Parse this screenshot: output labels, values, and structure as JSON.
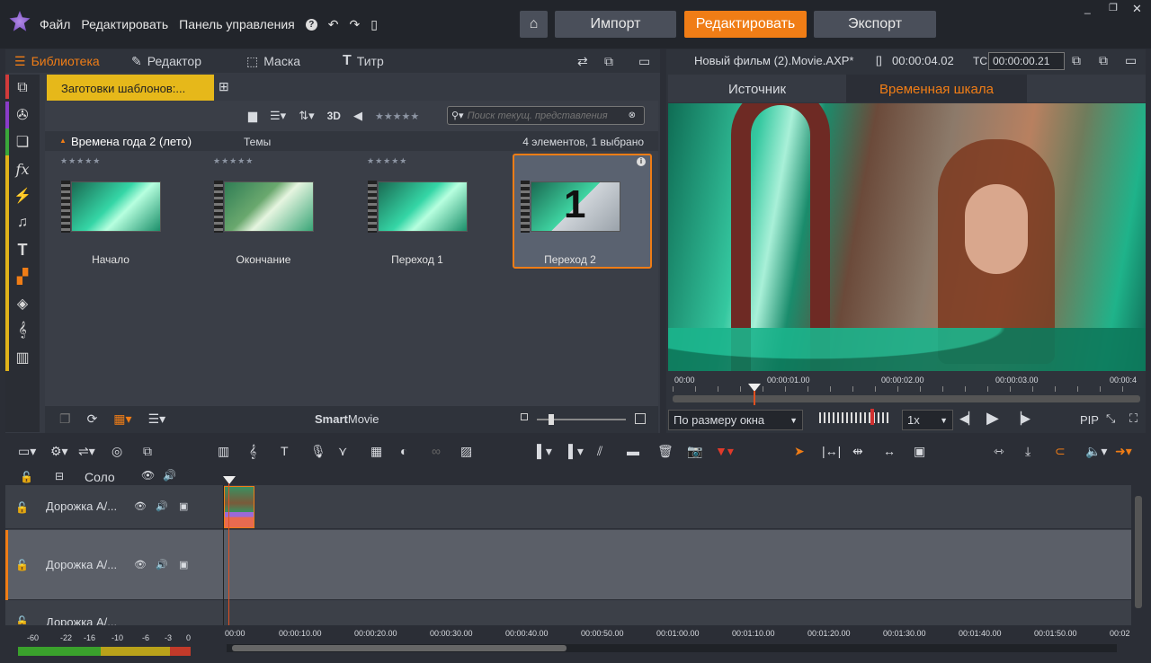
{
  "menu": {
    "file": "Файл",
    "edit": "Редактировать",
    "panel": "Панель управления",
    "help": "?"
  },
  "nav": {
    "import": "Импорт",
    "edit": "Редактировать",
    "export": "Экспорт"
  },
  "left_tabs": {
    "library": "Библиотека",
    "editor": "Редактор",
    "mask": "Маска",
    "title": "Титр"
  },
  "library": {
    "preset_tab": "Заготовки шаблонов:...",
    "search_placeholder": "Поиск текущ. представления",
    "toggle_3d": "3D",
    "group_title": "Времена года 2 (лето)",
    "group_sub": "Темы",
    "count": "4 элементов, 1 выбрано",
    "rating": "★★★★★",
    "items": [
      {
        "label": "Начало"
      },
      {
        "label": "Окончание"
      },
      {
        "label": "Переход 1"
      },
      {
        "label": "Переход 2"
      }
    ],
    "smartmovie_bold": "Smart",
    "smartmovie_rest": "Movie"
  },
  "preview": {
    "title": "Новый фильм (2).Movie.AXP*",
    "timecode": "00:00:04.02",
    "tc_label": "TC",
    "tc_value": "00:00:00.21",
    "tab_source": "Источник",
    "tab_timeline": "Временная шкала",
    "ruler": [
      "00:00",
      "00:00:01.00",
      "00:00:02.00",
      "00:00:03.00",
      "00:00:4"
    ],
    "fit": "По размеру окна",
    "speed": "1x",
    "pip": "PIP",
    "thumb_number": "1"
  },
  "timeline": {
    "solo": "Соло",
    "tracks": [
      {
        "name": "Дорожка А/..."
      },
      {
        "name": "Дорожка А/..."
      },
      {
        "name": "Дорожка А/..."
      }
    ],
    "ruler": [
      "00:00",
      "00:00:10.00",
      "00:00:20.00",
      "00:00:30.00",
      "00:00:40.00",
      "00:00:50.00",
      "00:01:00.00",
      "00:01:10.00",
      "00:01:20.00",
      "00:01:30.00",
      "00:01:40.00",
      "00:01:50.00",
      "00:02"
    ],
    "meter": [
      "-60",
      "-22",
      "-16",
      "-10",
      "-6",
      "-3",
      "0"
    ]
  },
  "colors": {
    "accent": "#f07d16",
    "bg": "#2b2e36"
  }
}
